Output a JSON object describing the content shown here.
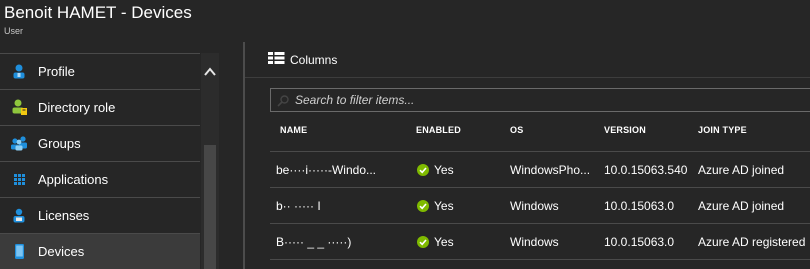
{
  "header": {
    "title": "Benoit HAMET - Devices",
    "subtitle": "User"
  },
  "sidebar": {
    "items": [
      {
        "label": "Profile",
        "icon": "user-icon",
        "active": false
      },
      {
        "label": "Directory role",
        "icon": "directory-role-icon",
        "active": false
      },
      {
        "label": "Groups",
        "icon": "groups-icon",
        "active": false
      },
      {
        "label": "Applications",
        "icon": "applications-grid-icon",
        "active": false
      },
      {
        "label": "Licenses",
        "icon": "licenses-icon",
        "active": false
      },
      {
        "label": "Devices",
        "icon": "device-icon",
        "active": true
      }
    ]
  },
  "toolbar": {
    "columns_label": "Columns",
    "columns_icon": "columns-icon"
  },
  "search": {
    "placeholder": "Search to filter items..."
  },
  "table": {
    "columns": [
      "NAME",
      "ENABLED",
      "OS",
      "VERSION",
      "JOIN TYPE"
    ],
    "rows": [
      {
        "name": "be····i·····-Windo...",
        "enabled": "Yes",
        "os": "WindowsPho...",
        "version": "10.0.15063.540",
        "join_type": "Azure AD joined"
      },
      {
        "name": "b·· ····· I",
        "enabled": "Yes",
        "os": "Windows",
        "version": "10.0.15063.0",
        "join_type": "Azure AD joined"
      },
      {
        "name": "B····· _ _ ·····)",
        "enabled": "Yes",
        "os": "Windows",
        "version": "10.0.15063.0",
        "join_type": "Azure AD registered"
      }
    ]
  },
  "colors": {
    "background": "#262626",
    "accent_blue": "#1f8fdc",
    "check_green": "#7fba00",
    "active_item": "#3b3b3b"
  }
}
